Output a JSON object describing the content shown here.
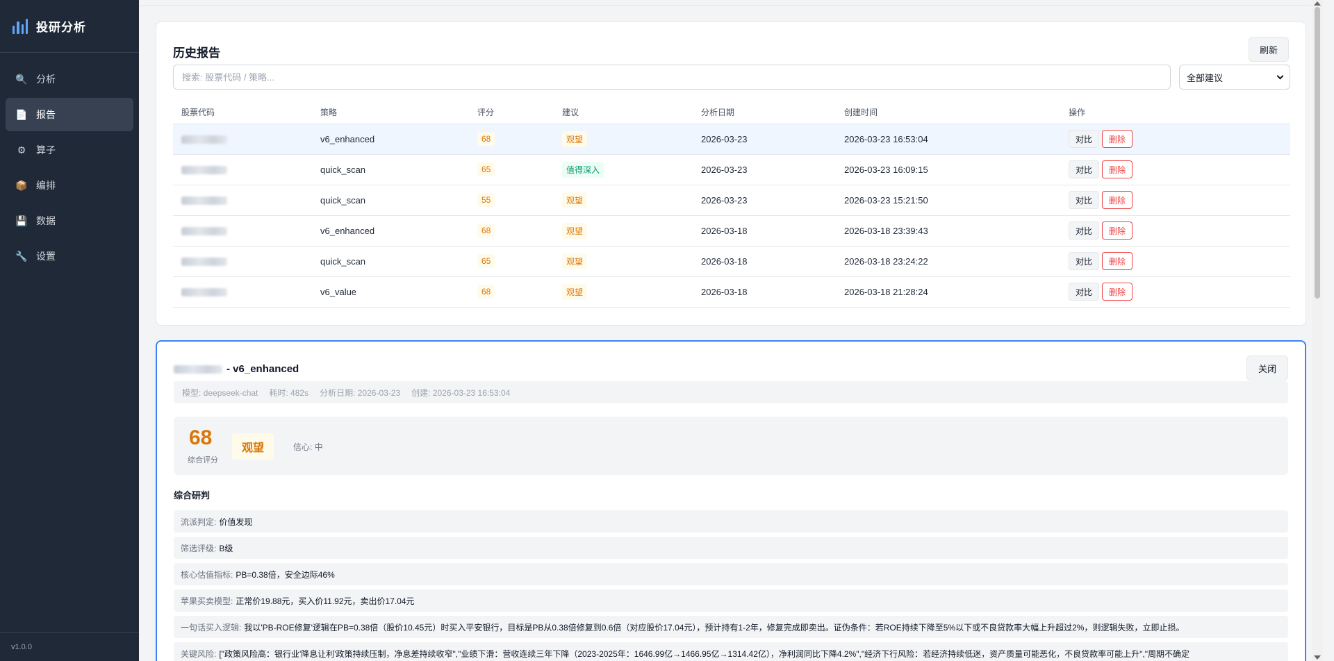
{
  "app": {
    "title": "投研分析",
    "version": "v1.0.0"
  },
  "sidebar": {
    "items": [
      {
        "label": "分析",
        "icon": "search-icon",
        "glyph": "🔍"
      },
      {
        "label": "报告",
        "icon": "document-icon",
        "glyph": "📄"
      },
      {
        "label": "算子",
        "icon": "gear-icon",
        "glyph": "⚙"
      },
      {
        "label": "编排",
        "icon": "package-icon",
        "glyph": "📦"
      },
      {
        "label": "数据",
        "icon": "disk-icon",
        "glyph": "💾"
      },
      {
        "label": "设置",
        "icon": "wrench-icon",
        "glyph": "🔧"
      }
    ],
    "active_index": 1
  },
  "history": {
    "title": "历史报告",
    "refresh_label": "刷新",
    "search_placeholder": "搜索: 股票代码 / 策略...",
    "filter_value": "全部建议",
    "columns": [
      "股票代码",
      "策略",
      "评分",
      "建议",
      "分析日期",
      "创建时间",
      "操作"
    ],
    "compare_label": "对比",
    "delete_label": "删除",
    "rows": [
      {
        "strategy": "v6_enhanced",
        "score": "68",
        "rec": "观望",
        "rec_type": "watch",
        "date": "2026-03-23",
        "created": "2026-03-23 16:53:04"
      },
      {
        "strategy": "quick_scan",
        "score": "65",
        "rec": "值得深入",
        "rec_type": "deep",
        "date": "2026-03-23",
        "created": "2026-03-23 16:09:15"
      },
      {
        "strategy": "quick_scan",
        "score": "55",
        "rec": "观望",
        "rec_type": "watch",
        "date": "2026-03-23",
        "created": "2026-03-23 15:21:50"
      },
      {
        "strategy": "v6_enhanced",
        "score": "68",
        "rec": "观望",
        "rec_type": "watch",
        "date": "2026-03-18",
        "created": "2026-03-18 23:39:43"
      },
      {
        "strategy": "quick_scan",
        "score": "65",
        "rec": "观望",
        "rec_type": "watch",
        "date": "2026-03-18",
        "created": "2026-03-18 23:24:22"
      },
      {
        "strategy": "v6_value",
        "score": "68",
        "rec": "观望",
        "rec_type": "watch",
        "date": "2026-03-18",
        "created": "2026-03-18 21:28:24"
      }
    ]
  },
  "detail": {
    "title_suffix": "- v6_enhanced",
    "close_label": "关闭",
    "meta": {
      "model": "模型: deepseek-chat",
      "duration": "耗时: 482s",
      "date": "分析日期: 2026-03-23",
      "created": "创建: 2026-03-23 16:53:04"
    },
    "score": "68",
    "score_label": "综合评分",
    "recommendation": "观望",
    "confidence": "信心: 中",
    "section_title": "综合研判",
    "items": [
      {
        "key": "流派判定:",
        "value": "价值发现"
      },
      {
        "key": "筛选评级:",
        "value": "B级"
      },
      {
        "key": "核心估值指标:",
        "value": "PB=0.38倍，安全边际46%"
      },
      {
        "key": "苹果买卖模型:",
        "value": "正常价19.88元，买入价11.92元，卖出价17.04元"
      },
      {
        "key": "一句话买入逻辑:",
        "value": "我以'PB-ROE修复'逻辑在PB=0.38倍（股价10.45元）时买入平安银行，目标是PB从0.38倍修复到0.6倍（对应股价17.04元），预计持有1-2年，修复完成即卖出。证伪条件：若ROE持续下降至5%以下或不良贷款率大幅上升超过2%，则逻辑失败，立即止损。"
      },
      {
        "key": "关键风险:",
        "value": "[\"政策风险高：银行业'降息让利'政策持续压制，净息差持续收窄\",\"业绩下滑：营收连续三年下降（2023-2025年：1646.99亿→1466.95亿→1314.42亿），净利润同比下降4.2%\",\"经济下行风险：若经济持续低迷，资产质量可能恶化，不良贷款率可能上升\",\"周期不确定"
      }
    ]
  }
}
